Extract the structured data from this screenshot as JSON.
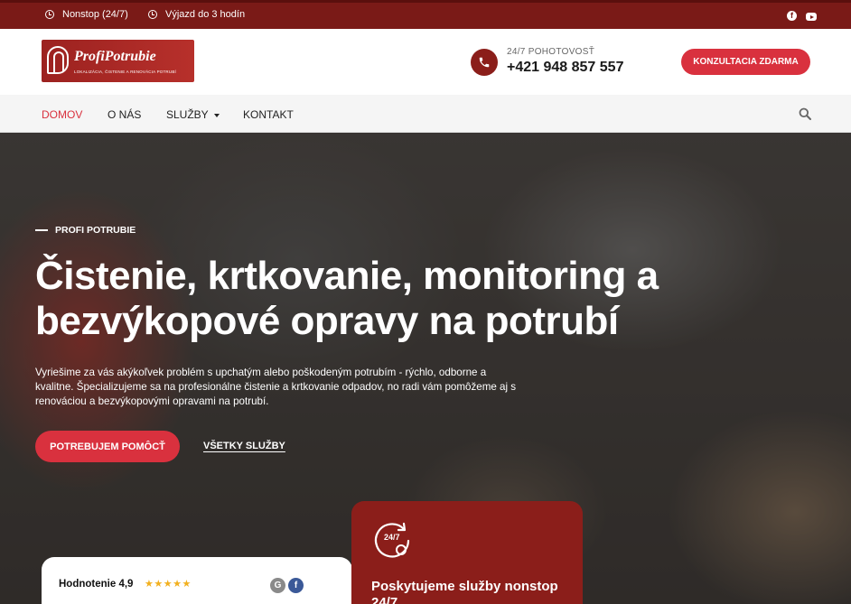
{
  "topbar": {
    "nonstop_label": "Nonstop (24/7)",
    "dispatch_label": "Výjazd do 3 hodín",
    "social": [
      "facebook-icon",
      "youtube-icon"
    ],
    "background": "#7a1a17"
  },
  "header": {
    "logo_name": "ProfiPotrubie",
    "logo_tagline": "LOKALIZÁCIA, ČISTENIE A RENOVÁCIA POTRUBÍ",
    "phone_label": "24/7 POHOTOVOSŤ",
    "phone_number": "+421 948 857 557",
    "cta_label": "KONZULTACIA ZDARMA",
    "accent": "#d9313e"
  },
  "nav": {
    "items": [
      {
        "label": "DOMOV",
        "active": true
      },
      {
        "label": "O NÁS",
        "active": false
      },
      {
        "label": "SLUŽBY",
        "active": false,
        "dropdown": true
      },
      {
        "label": "KONTAKT",
        "active": false
      }
    ],
    "search_icon": "search-icon"
  },
  "hero": {
    "eyebrow": "PROFI POTRUBIE",
    "headline": "Čistenie, krtkovanie, monitoring a bezvýkopové opravy na potrubí",
    "lead": "Vyriešime za vás akýkoľvek problém s upchatým alebo poškodeným potrubím - rýchlo, odborne a kvalitne. Špecializujeme sa na profesionálne čistenie a krtkovanie odpadov, no radi vám pomôžeme aj s renováciou a bezvýkopovými opravami na potrubí.",
    "primary_button": "POTREBUJEM POMÔCŤ",
    "secondary_link": "VŠETKY SLUŽBY"
  },
  "rating_card": {
    "title": "Hodnotenie 4,9",
    "stars": "★★★★★",
    "icons": [
      "google-icon",
      "facebook-icon"
    ]
  },
  "nonstop_card": {
    "icon": "24-7-service-icon",
    "icon_text": "24/7",
    "title": "Poskytujeme služby nonstop 24/7",
    "background": "#8b1e1a"
  }
}
